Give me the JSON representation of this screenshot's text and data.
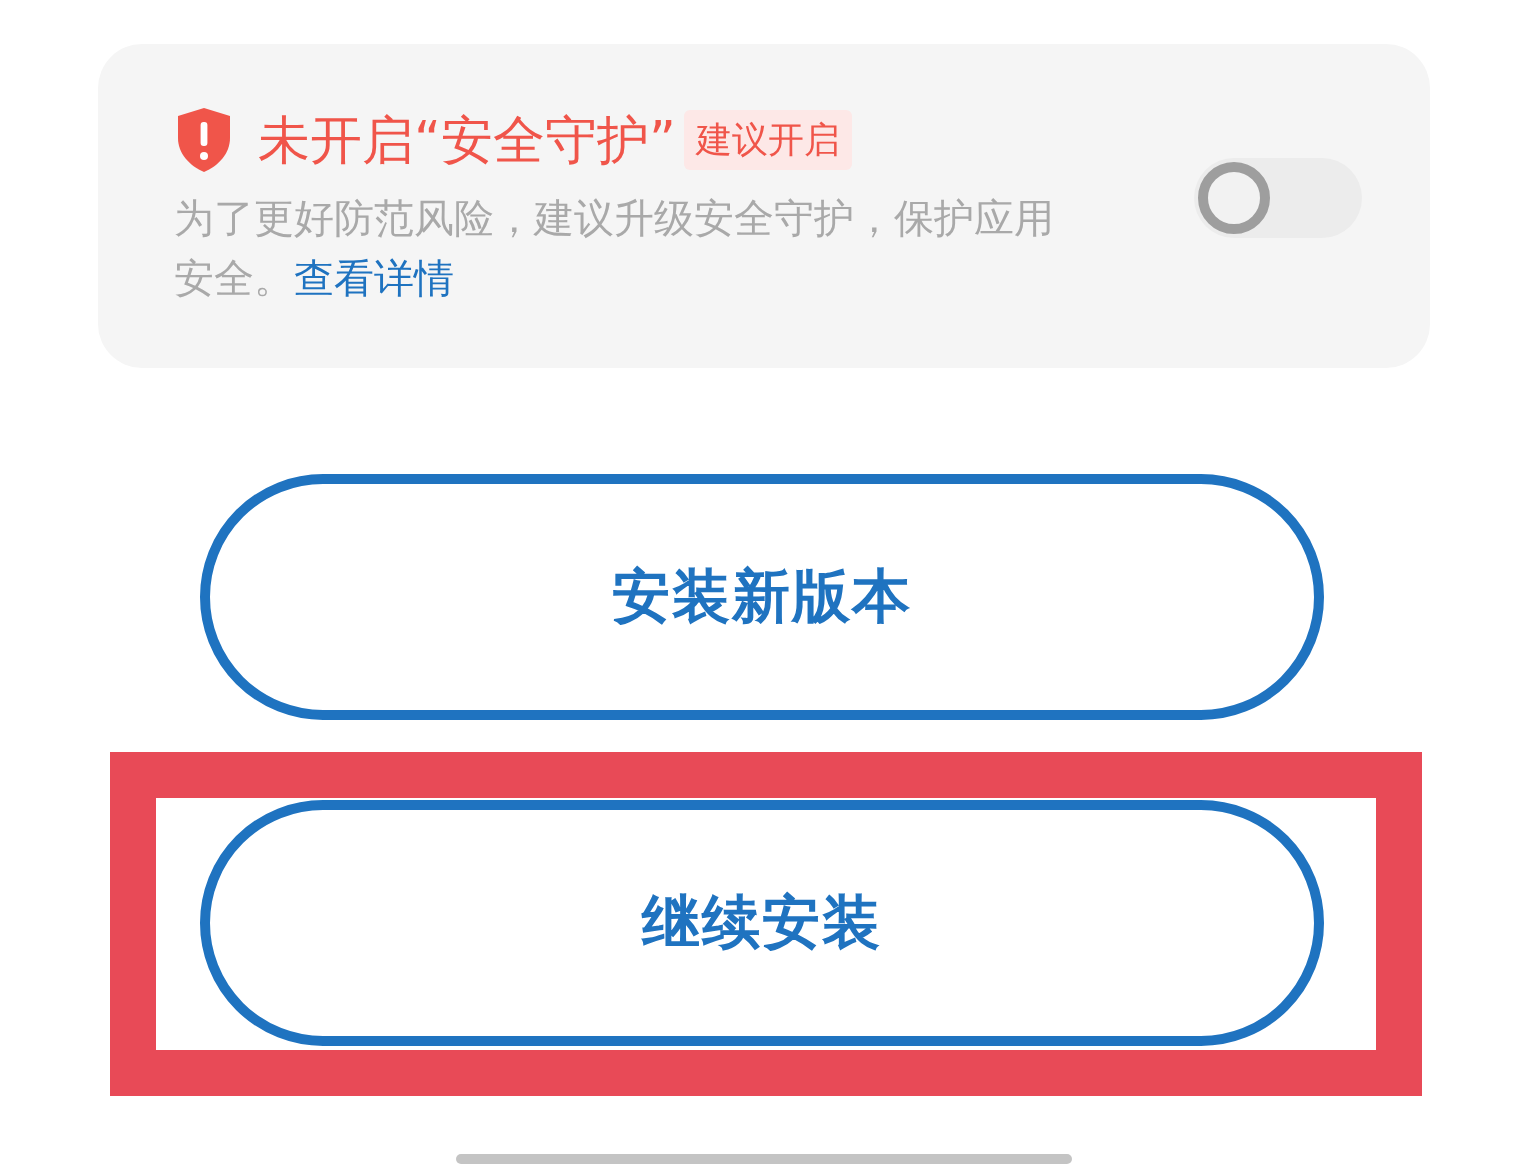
{
  "security_card": {
    "title": "未开启“安全守护”",
    "badge": "建议开启",
    "description": "为了更好防范风险，建议升级安全守护，保护应用安全。",
    "link": "查看详情",
    "toggle": {
      "on": false
    }
  },
  "buttons": [
    {
      "label": "安装新版本",
      "highlighted": false
    },
    {
      "label": "继续安装",
      "highlighted": true
    }
  ]
}
